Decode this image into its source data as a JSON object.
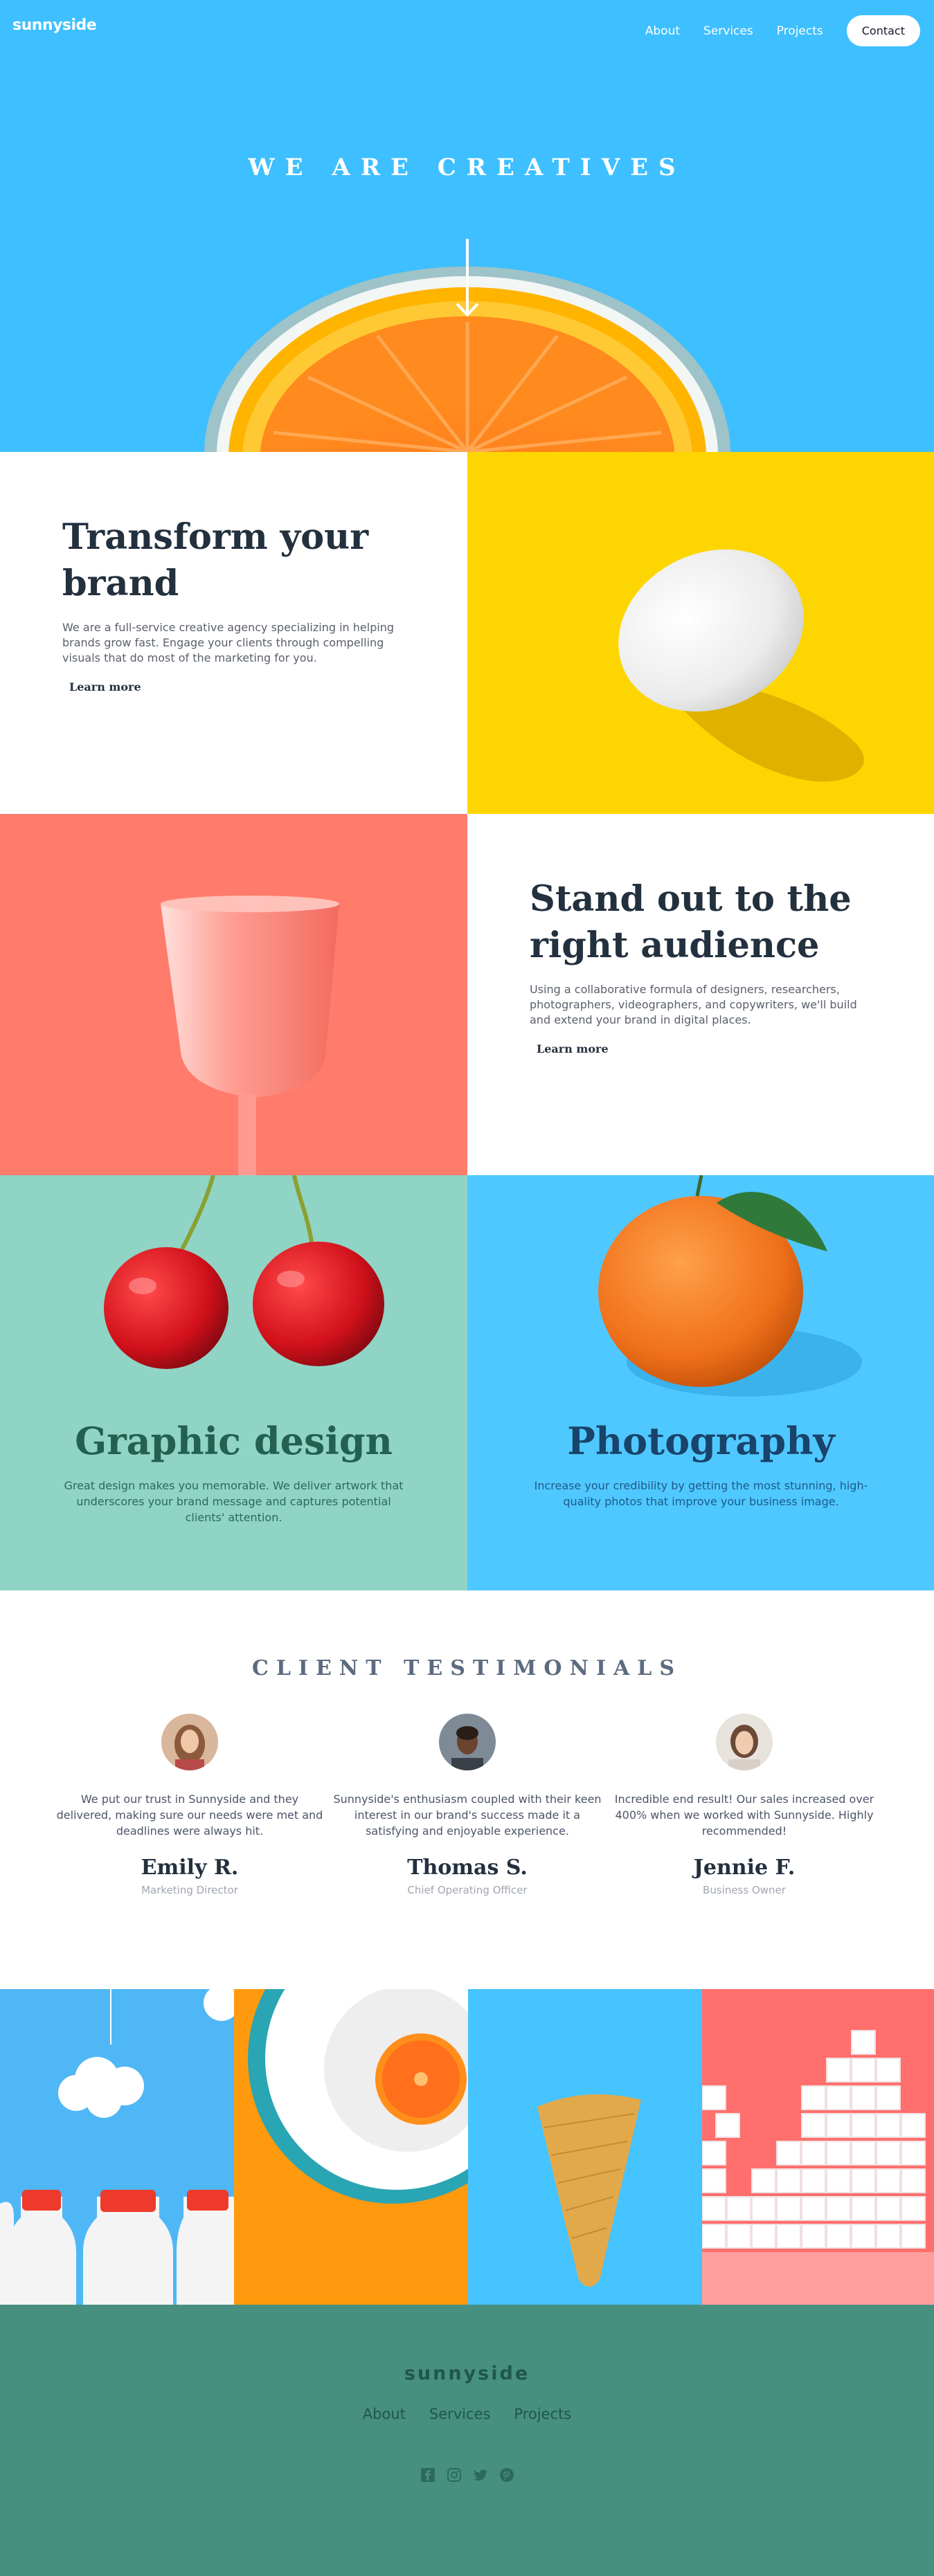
{
  "header": {
    "logo": "sunnyside",
    "nav": {
      "about": "About",
      "services": "Services",
      "projects": "Projects",
      "contact": "Contact"
    }
  },
  "hero": {
    "title": "WE ARE CREATIVES",
    "icon": "arrow-down-icon"
  },
  "transform": {
    "heading": "Transform your brand",
    "body": "We are a full-service creative agency specializing in helping brands grow fast. Engage your clients through compelling visuals that do most of the marketing for you.",
    "cta": "Learn more",
    "underline_color": "#fad400"
  },
  "standout": {
    "heading": "Stand out to the right audience",
    "body": "Using a collaborative formula of designers, researchers, photographers, videographers, and copywriters, we'll build and extend your brand in digital places.",
    "cta": "Learn more",
    "underline_color": "#fad400"
  },
  "services": {
    "graphic": {
      "title": "Graphic design",
      "body": "Great design makes you memorable. We deliver artwork that underscores your brand message and captures potential clients' attention."
    },
    "photography": {
      "title": "Photography",
      "body": "Increase your credibility by getting the most stunning, high-quality photos that improve your business image."
    }
  },
  "testimonials": {
    "title": "CLIENT TESTIMONIALS",
    "items": [
      {
        "quote": "We put our trust in Sunnyside and they delivered, making sure our needs were met and deadlines were always hit.",
        "name": "Emily R.",
        "role": "Marketing Director"
      },
      {
        "quote": "Sunnyside's enthusiasm coupled with their keen interest in our brand's success made it a satisfying and enjoyable experience.",
        "name": "Thomas S.",
        "role": "Chief Operating Officer"
      },
      {
        "quote": "Incredible end result! Our sales increased over 400% when we worked with Sunnyside. Highly recommended!",
        "name": "Jennie F.",
        "role": "Business Owner"
      }
    ]
  },
  "footer": {
    "logo": "sunnyside",
    "nav": {
      "about": "About",
      "services": "Services",
      "projects": "Projects"
    },
    "social": [
      "facebook-icon",
      "instagram-icon",
      "twitter-icon",
      "pinterest-icon"
    ]
  },
  "colors": {
    "hero_blue": "#3ebfff",
    "yellow": "#fdd601",
    "coral": "#ff7b6b",
    "mint": "#90d4c5",
    "sky": "#4fc8ff",
    "footer_green": "#478f7f",
    "dark_text": "#23303e",
    "graphic_title": "#24604f",
    "photo_title": "#19436a"
  }
}
